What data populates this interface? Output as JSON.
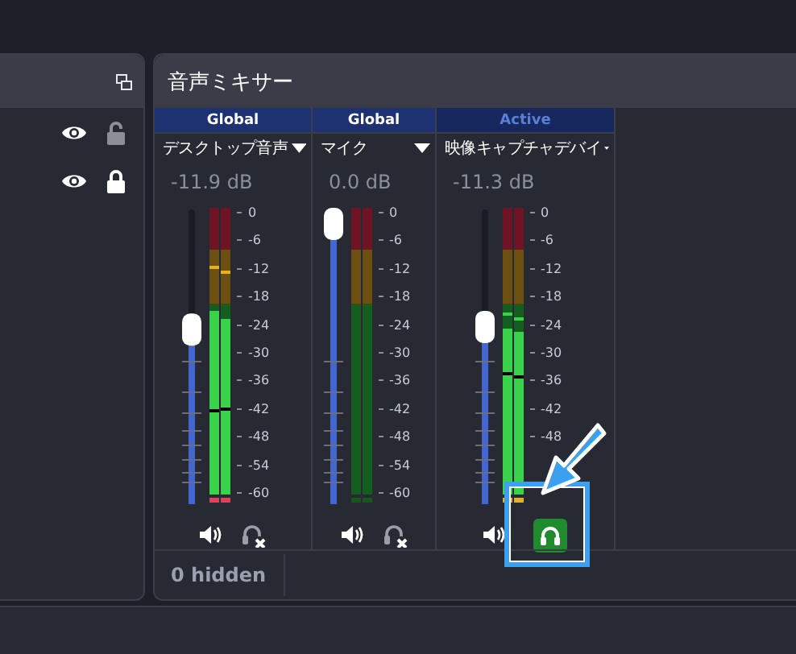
{
  "left_panel": {
    "sources": [
      {
        "visible": true,
        "locked": false
      },
      {
        "visible": true,
        "locked": true
      }
    ]
  },
  "mixer": {
    "title": "音声ミキサー",
    "channels": [
      {
        "mode": {
          "label": "Global",
          "active": false
        },
        "name": "デスクトップ音声",
        "reading": "-11.9 dB",
        "fader": {
          "level": 0.6
        },
        "meters": [
          {
            "level": 0.64,
            "peak": {
              "level": 0.79
            },
            "hold": {
              "level": 0.29
            },
            "clip": {
              "color": "#e0405a"
            }
          },
          {
            "level": 0.61,
            "peak": {
              "level": 0.775
            },
            "hold": {
              "level": 0.3
            },
            "clip": {
              "color": "#e0405a"
            }
          }
        ],
        "scale": [
          "0",
          "-6",
          "-12",
          "-18",
          "-24",
          "-30",
          "-36",
          "-42",
          "-48",
          "-54",
          "-60"
        ],
        "muted": false,
        "monitoring": false
      },
      {
        "mode": {
          "label": "Global",
          "active": false
        },
        "name": "マイク",
        "reading": "0.0 dB",
        "fader": {
          "level": 1
        },
        "meters": [
          {
            "clip": {
              "color": "#17561f"
            }
          },
          {
            "clip": {
              "color": "#17561f"
            }
          }
        ],
        "scale": [
          "0",
          "-6",
          "-12",
          "-18",
          "-24",
          "-30",
          "-36",
          "-42",
          "-48",
          "-54",
          "-60"
        ],
        "muted": false,
        "monitoring": false
      },
      {
        "mode": {
          "label": "Active",
          "active": true
        },
        "name": "映像キャプチャデバイ",
        "reading": "-11.3 dB",
        "fader": {
          "level": 0.61
        },
        "meters": [
          {
            "level": 0.58,
            "peak": {
              "level": 0.63
            },
            "hold": {
              "level": 0.42
            },
            "clip": {
              "color": "#e0b030"
            }
          },
          {
            "level": 0.57,
            "peak": {
              "level": 0.615
            },
            "hold": {
              "level": 0.41
            },
            "clip": {
              "color": "#e0b030"
            }
          }
        ],
        "scale": [
          "0",
          "-6",
          "-12",
          "-18",
          "-24",
          "-30",
          "-36",
          "-42",
          "-48"
        ],
        "muted": false,
        "monitoring": true
      }
    ],
    "footer": "0 hidden"
  }
}
